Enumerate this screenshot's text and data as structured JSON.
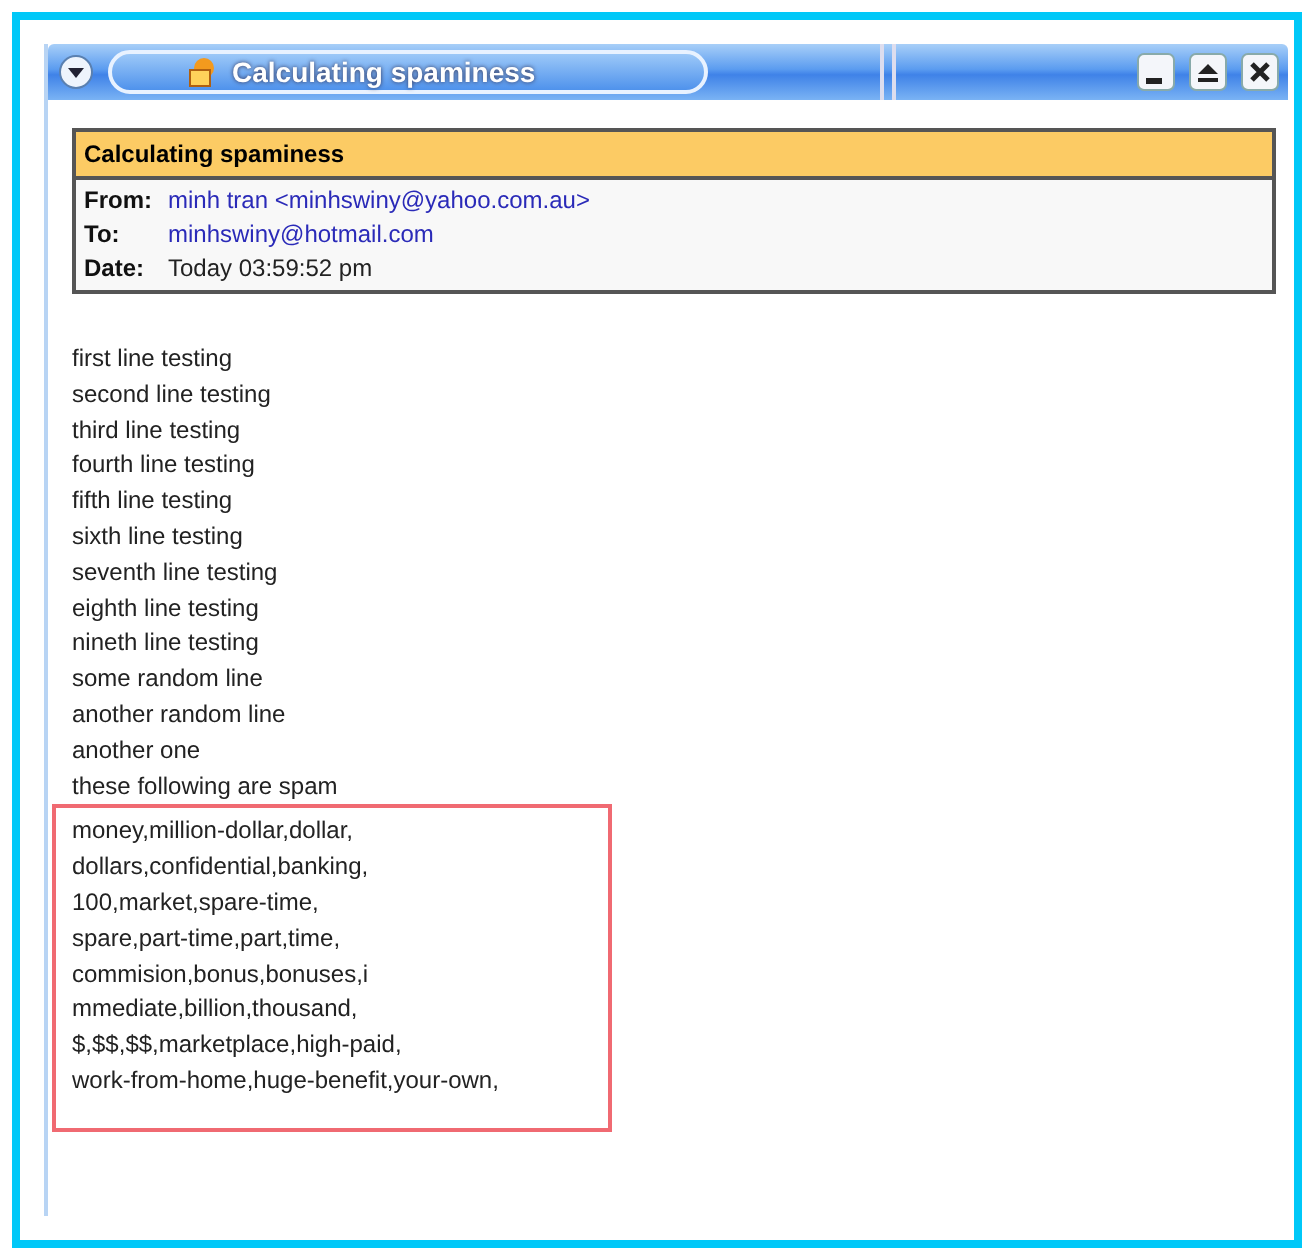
{
  "window": {
    "title": "Calculating spaminess"
  },
  "header": {
    "subject": "Calculating spaminess",
    "fields": [
      {
        "label": "From:",
        "value": "minh tran <minhswiny@yahoo.com.au>",
        "kind": "link"
      },
      {
        "label": "To:",
        "value": "minhswiny@hotmail.com",
        "kind": "link"
      },
      {
        "label": "Date:",
        "value": "Today 03:59:52 pm",
        "kind": "plain"
      }
    ]
  },
  "body_lines": [
    "first line testing",
    "second line testing",
    "third line testing",
    "fourth line testing",
    "fifth line testing",
    "sixth line testing",
    "seventh line testing",
    "eighth line testing",
    "nineth line testing",
    "some random line",
    "another random line",
    "another one",
    "these following are spam"
  ],
  "highlighted_lines": [
    "money,million-dollar,dollar,",
    "dollars,confidential,banking,",
    "100,market,spare-time,",
    "spare,part-time,part,time,",
    "commision,bonus,bonuses,i",
    "mmediate,billion,thousand,",
    "$,$$,$$,marketplace,high-paid,",
    "work-from-home,huge-benefit,your-own,"
  ]
}
